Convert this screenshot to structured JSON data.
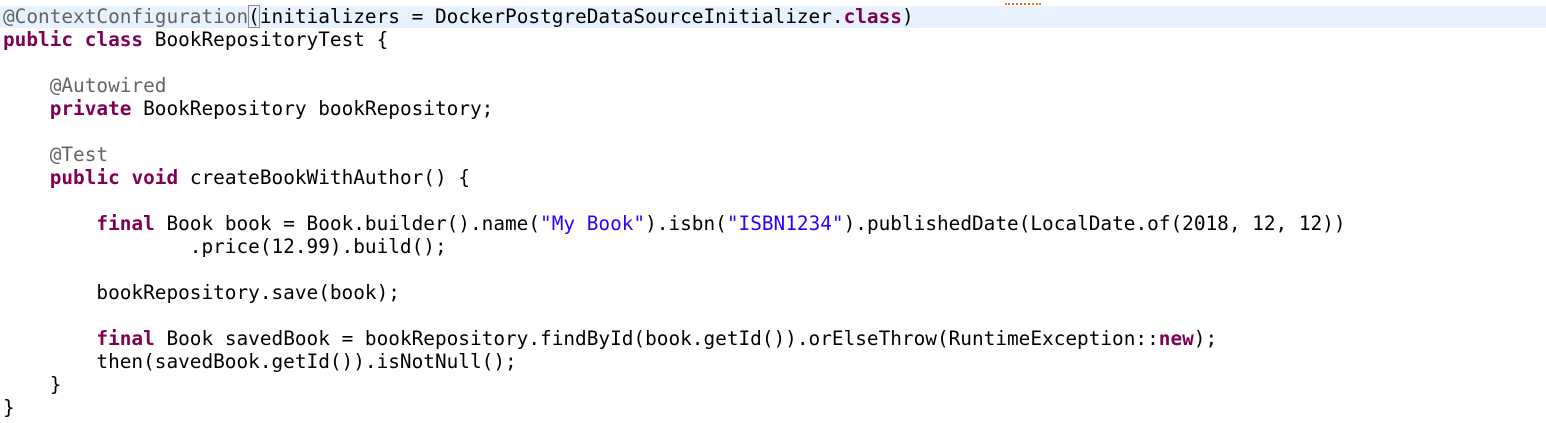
{
  "editor": {
    "lines": [
      {
        "segments": [
          {
            "text": "@ContextConfiguration",
            "style": "ann"
          },
          {
            "text": "(",
            "style": "bracket"
          },
          {
            "text": "initializers = DockerPostgreDataSourceInitializer.",
            "style": "plain"
          },
          {
            "text": "class",
            "style": "kw"
          },
          {
            "text": ")",
            "style": "plain"
          }
        ]
      },
      {
        "segments": [
          {
            "text": "public",
            "style": "kw"
          },
          {
            "text": " ",
            "style": "plain"
          },
          {
            "text": "class",
            "style": "kw"
          },
          {
            "text": " BookRepositoryTest {",
            "style": "plain"
          }
        ]
      },
      {
        "segments": []
      },
      {
        "segments": [
          {
            "text": "    ",
            "style": "plain"
          },
          {
            "text": "@Autowired",
            "style": "ann"
          }
        ]
      },
      {
        "segments": [
          {
            "text": "    ",
            "style": "plain"
          },
          {
            "text": "private",
            "style": "kw"
          },
          {
            "text": " BookRepository bookRepository;",
            "style": "plain"
          }
        ]
      },
      {
        "segments": []
      },
      {
        "segments": [
          {
            "text": "    ",
            "style": "plain"
          },
          {
            "text": "@Test",
            "style": "ann"
          }
        ]
      },
      {
        "segments": [
          {
            "text": "    ",
            "style": "plain"
          },
          {
            "text": "public",
            "style": "kw"
          },
          {
            "text": " ",
            "style": "plain"
          },
          {
            "text": "void",
            "style": "kw"
          },
          {
            "text": " createBookWithAuthor() {",
            "style": "plain"
          }
        ]
      },
      {
        "segments": []
      },
      {
        "segments": [
          {
            "text": "        ",
            "style": "plain"
          },
          {
            "text": "final",
            "style": "kw"
          },
          {
            "text": " Book book = Book.builder().name(",
            "style": "plain"
          },
          {
            "text": "\"My Book\"",
            "style": "str"
          },
          {
            "text": ").isbn(",
            "style": "plain"
          },
          {
            "text": "\"ISBN1234\"",
            "style": "str"
          },
          {
            "text": ").publishedDate(LocalDate.of(2018, 12, 12))",
            "style": "plain"
          }
        ]
      },
      {
        "segments": [
          {
            "text": "                .price(12.99).build();",
            "style": "plain"
          }
        ]
      },
      {
        "segments": []
      },
      {
        "segments": [
          {
            "text": "        bookRepository.save(book);",
            "style": "plain"
          }
        ]
      },
      {
        "segments": []
      },
      {
        "segments": [
          {
            "text": "        ",
            "style": "plain"
          },
          {
            "text": "final",
            "style": "kw"
          },
          {
            "text": " Book savedBook = bookRepository.findById(book.getId()).orElseThrow(RuntimeException::",
            "style": "plain"
          },
          {
            "text": "new",
            "style": "kw"
          },
          {
            "text": ");",
            "style": "plain"
          }
        ]
      },
      {
        "segments": [
          {
            "text": "        then(savedBook.getId()).isNotNull();",
            "style": "plain"
          }
        ]
      },
      {
        "segments": [
          {
            "text": "    }",
            "style": "plain"
          }
        ]
      },
      {
        "segments": [
          {
            "text": "}",
            "style": "plain"
          }
        ]
      }
    ]
  },
  "colors": {
    "keyword": "#7f0055",
    "string": "#2a00ff",
    "annotation": "#646464",
    "current_line": "#e8f2fe"
  }
}
